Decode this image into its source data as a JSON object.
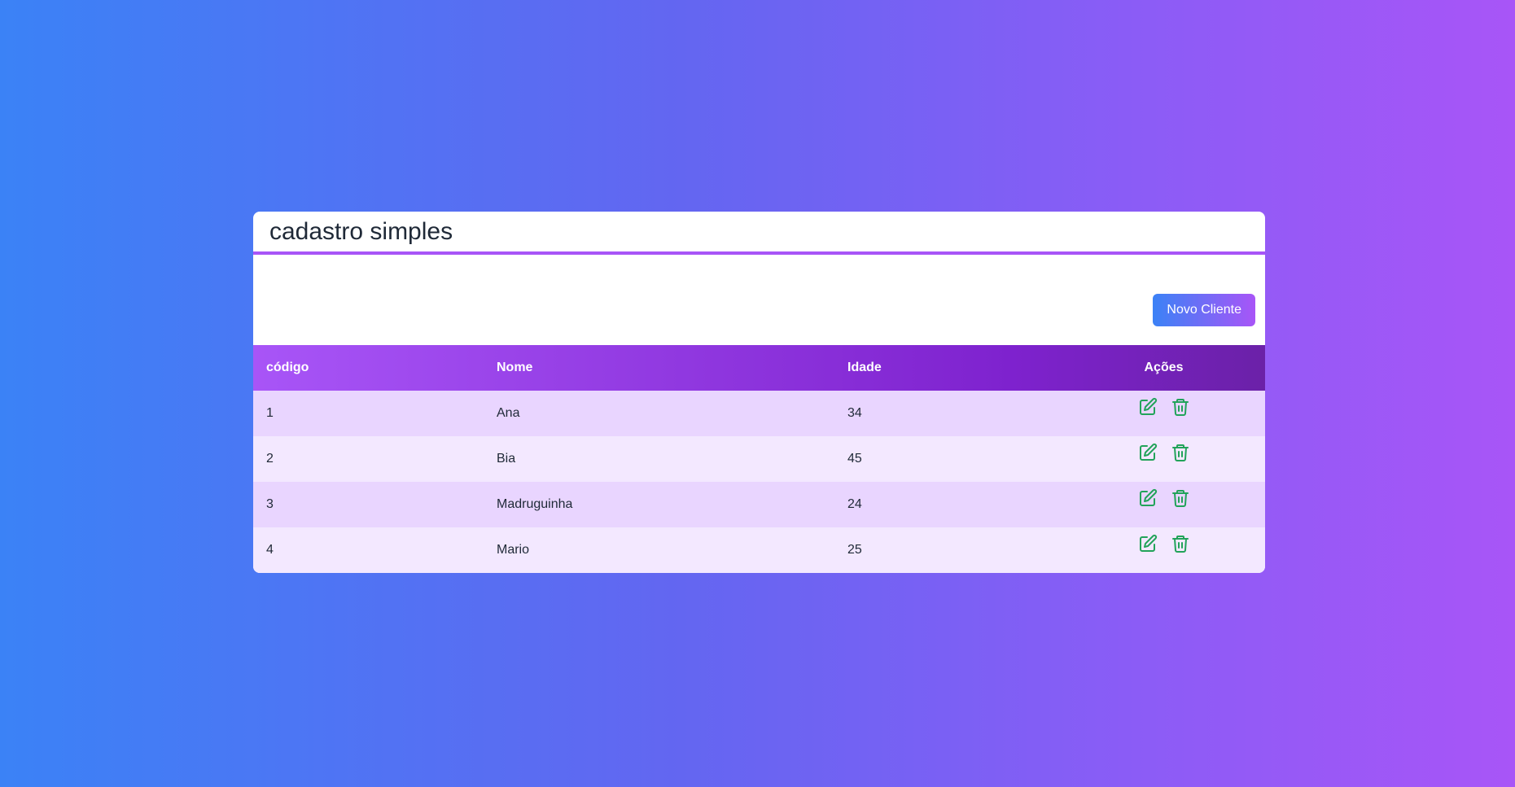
{
  "page": {
    "title": "cadastro simples"
  },
  "toolbar": {
    "new_client_label": "Novo Cliente"
  },
  "table": {
    "columns": [
      "código",
      "Nome",
      "Idade",
      "Ações"
    ],
    "rows": [
      {
        "codigo": "1",
        "nome": "Ana",
        "idade": "34"
      },
      {
        "codigo": "2",
        "nome": "Bia",
        "idade": "45"
      },
      {
        "codigo": "3",
        "nome": "Madruguinha",
        "idade": "24"
      },
      {
        "codigo": "4",
        "nome": "Mario",
        "idade": "25"
      }
    ],
    "row_actions": [
      "edit-icon",
      "trash-icon"
    ]
  },
  "colors": {
    "accent": "#a855f7",
    "header_dark": "#6b21a8",
    "row_odd": "#e9d5ff",
    "row_even": "#f3e8ff",
    "icon_green": "#22a35a",
    "bg_start": "#3b82f6",
    "bg_end": "#a855f7"
  }
}
